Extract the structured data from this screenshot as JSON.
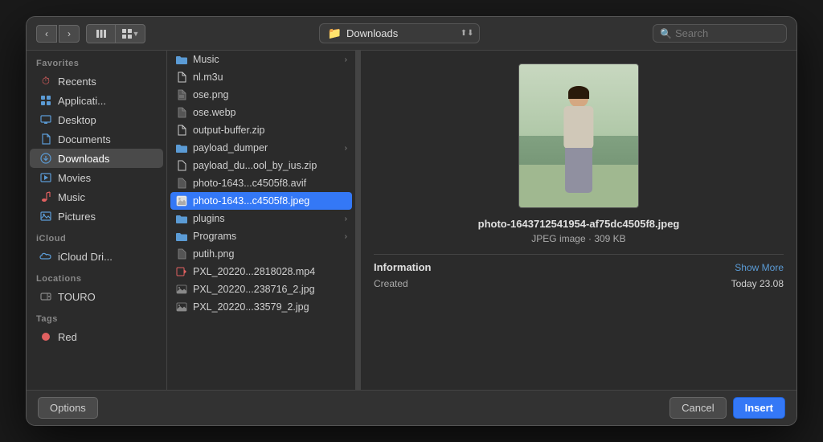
{
  "toolbar": {
    "back_label": "‹",
    "forward_label": "›",
    "view_columns_label": "⊞",
    "view_grid_label": "⊟",
    "location_label": "Downloads",
    "search_placeholder": "Search"
  },
  "sidebar": {
    "favorites_label": "Favorites",
    "icloud_label": "iCloud",
    "locations_label": "Locations",
    "tags_label": "Tags",
    "items": [
      {
        "id": "recents",
        "label": "Recents",
        "icon": "🕐",
        "icon_class": "si-recents"
      },
      {
        "id": "applications",
        "label": "Applicati...",
        "icon": "🖥",
        "icon_class": "si-apps"
      },
      {
        "id": "desktop",
        "label": "Desktop",
        "icon": "🖥",
        "icon_class": "si-desktop"
      },
      {
        "id": "documents",
        "label": "Documents",
        "icon": "📄",
        "icon_class": "si-documents"
      },
      {
        "id": "downloads",
        "label": "Downloads",
        "icon": "⬇",
        "icon_class": "si-downloads",
        "active": true
      },
      {
        "id": "movies",
        "label": "Movies",
        "icon": "🎬",
        "icon_class": "si-movies"
      },
      {
        "id": "music",
        "label": "Music",
        "icon": "🎵",
        "icon_class": "si-music"
      },
      {
        "id": "pictures",
        "label": "Pictures",
        "icon": "🖼",
        "icon_class": "si-pictures"
      },
      {
        "id": "icloud-drive",
        "label": "iCloud Dri...",
        "icon": "☁",
        "icon_class": "si-icloud"
      },
      {
        "id": "touro",
        "label": "TOURO",
        "icon": "💾",
        "icon_class": "si-drive"
      },
      {
        "id": "red",
        "label": "Red",
        "icon": "🔴",
        "icon_class": "si-red"
      }
    ]
  },
  "files": [
    {
      "name": "Music",
      "type": "folder",
      "arrow": true
    },
    {
      "name": "nl.m3u",
      "type": "file",
      "arrow": false
    },
    {
      "name": "ose.png",
      "type": "image",
      "arrow": false
    },
    {
      "name": "ose.webp",
      "type": "image",
      "arrow": false
    },
    {
      "name": "output-buffer.zip",
      "type": "file",
      "arrow": false
    },
    {
      "name": "payload_dumper",
      "type": "folder",
      "arrow": true
    },
    {
      "name": "payload_du...ool_by_ius.zip",
      "type": "file",
      "arrow": false
    },
    {
      "name": "photo-1643...c4505f8.avif",
      "type": "image",
      "arrow": false
    },
    {
      "name": "photo-1643...c4505f8.jpeg",
      "type": "image_selected",
      "arrow": false
    },
    {
      "name": "plugins",
      "type": "folder",
      "arrow": true
    },
    {
      "name": "Programs",
      "type": "folder",
      "arrow": true
    },
    {
      "name": "putih.png",
      "type": "image",
      "arrow": false
    },
    {
      "name": "PXL_20220...2818028.mp4",
      "type": "file",
      "arrow": false
    },
    {
      "name": "PXL_20220...238716_2.jpg",
      "type": "image",
      "arrow": false
    },
    {
      "name": "PXL_20220...33579_2.jpg",
      "type": "image",
      "arrow": false
    }
  ],
  "preview": {
    "filename": "photo-1643712541954-af75dc4505f8.jpeg",
    "filetype": "JPEG image · 309 KB",
    "info_label": "Information",
    "show_more_label": "Show More",
    "created_key": "Created",
    "created_value": "Today 23.08"
  },
  "footer": {
    "options_label": "Options",
    "cancel_label": "Cancel",
    "insert_label": "Insert"
  }
}
